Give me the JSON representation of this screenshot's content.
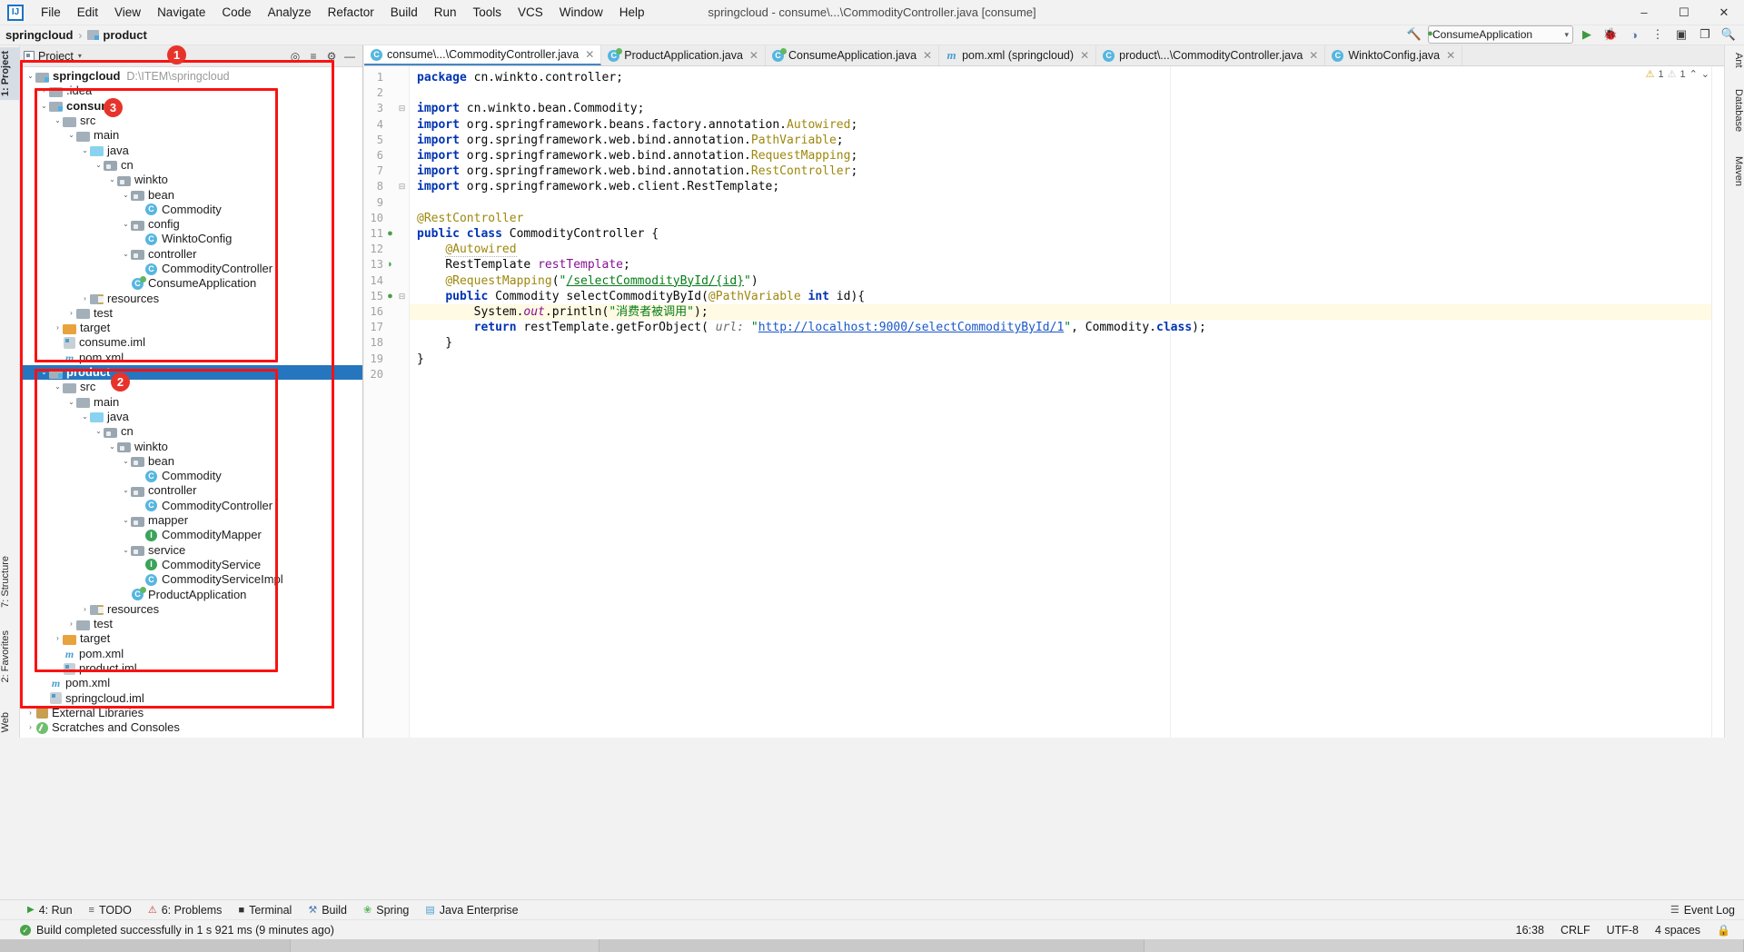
{
  "window": {
    "title": "springcloud - consume\\...\\CommodityController.java [consume]",
    "minimize": "–",
    "maximize": "☐",
    "close": "✕"
  },
  "menu": {
    "items": [
      "File",
      "Edit",
      "View",
      "Navigate",
      "Code",
      "Analyze",
      "Refactor",
      "Build",
      "Run",
      "Tools",
      "VCS",
      "Window",
      "Help"
    ]
  },
  "breadcrumb": {
    "project": "springcloud",
    "separator": "›",
    "module": "product"
  },
  "toolbar": {
    "build_hammer": "🔨",
    "run_config": "ConsumeApplication",
    "chevron": "▾",
    "run_label": "▶",
    "debug_label": "🐞",
    "coverage_label": "◑",
    "more_label": "⋮",
    "search_label": "🔍",
    "settings_label": "⚙",
    "layout1": "▣",
    "layout2": "❐"
  },
  "left_tool_strips": [
    {
      "label": "1: Project",
      "selected": true
    },
    {
      "label": "7: Structure",
      "selected": false
    },
    {
      "label": "2: Favorites",
      "selected": false
    },
    {
      "label": "Web",
      "selected": false
    }
  ],
  "right_tool_strips": [
    {
      "label": "Ant"
    },
    {
      "label": "Database"
    },
    {
      "label": "Maven"
    }
  ],
  "project_panel": {
    "header_label": "Project",
    "header_chevron": "▾",
    "icons": {
      "locate": "◎",
      "collapse": "≡",
      "settings": "⚙",
      "hide": "—"
    },
    "tree": [
      {
        "depth": 0,
        "arrow": "⌄",
        "icon": "module",
        "name": "springcloud",
        "bold": true,
        "path": "D:\\ITEM\\springcloud"
      },
      {
        "depth": 1,
        "arrow": "›",
        "icon": "folder",
        "name": ".idea"
      },
      {
        "depth": 1,
        "arrow": "⌄",
        "icon": "module",
        "name": "consume",
        "bold": true
      },
      {
        "depth": 2,
        "arrow": "⌄",
        "icon": "folder",
        "name": "src"
      },
      {
        "depth": 3,
        "arrow": "⌄",
        "icon": "folder",
        "name": "main"
      },
      {
        "depth": 4,
        "arrow": "⌄",
        "icon": "folder-blue",
        "name": "java"
      },
      {
        "depth": 5,
        "arrow": "⌄",
        "icon": "package",
        "name": "cn"
      },
      {
        "depth": 6,
        "arrow": "⌄",
        "icon": "package",
        "name": "winkto"
      },
      {
        "depth": 7,
        "arrow": "⌄",
        "icon": "package",
        "name": "bean"
      },
      {
        "depth": 8,
        "arrow": "",
        "icon": "class",
        "name": "Commodity"
      },
      {
        "depth": 7,
        "arrow": "⌄",
        "icon": "package",
        "name": "config"
      },
      {
        "depth": 8,
        "arrow": "",
        "icon": "class",
        "name": "WinktoConfig"
      },
      {
        "depth": 7,
        "arrow": "⌄",
        "icon": "package",
        "name": "controller"
      },
      {
        "depth": 8,
        "arrow": "",
        "icon": "class",
        "name": "CommodityController"
      },
      {
        "depth": 7,
        "arrow": "",
        "icon": "springapp",
        "name": "ConsumeApplication"
      },
      {
        "depth": 4,
        "arrow": "›",
        "icon": "resources",
        "name": "resources"
      },
      {
        "depth": 3,
        "arrow": "›",
        "icon": "folder",
        "name": "test"
      },
      {
        "depth": 2,
        "arrow": "›",
        "icon": "folder-orange",
        "name": "target"
      },
      {
        "depth": 2,
        "arrow": "",
        "icon": "iml",
        "name": "consume.iml"
      },
      {
        "depth": 2,
        "arrow": "",
        "icon": "xml",
        "name": "pom.xml"
      },
      {
        "depth": 1,
        "arrow": "⌄",
        "icon": "module",
        "name": "product",
        "bold": true,
        "selected": true
      },
      {
        "depth": 2,
        "arrow": "⌄",
        "icon": "folder",
        "name": "src"
      },
      {
        "depth": 3,
        "arrow": "⌄",
        "icon": "folder",
        "name": "main"
      },
      {
        "depth": 4,
        "arrow": "⌄",
        "icon": "folder-blue",
        "name": "java"
      },
      {
        "depth": 5,
        "arrow": "⌄",
        "icon": "package",
        "name": "cn"
      },
      {
        "depth": 6,
        "arrow": "⌄",
        "icon": "package",
        "name": "winkto"
      },
      {
        "depth": 7,
        "arrow": "⌄",
        "icon": "package",
        "name": "bean"
      },
      {
        "depth": 8,
        "arrow": "",
        "icon": "class",
        "name": "Commodity"
      },
      {
        "depth": 7,
        "arrow": "⌄",
        "icon": "package",
        "name": "controller"
      },
      {
        "depth": 8,
        "arrow": "",
        "icon": "class",
        "name": "CommodityController"
      },
      {
        "depth": 7,
        "arrow": "⌄",
        "icon": "package",
        "name": "mapper"
      },
      {
        "depth": 8,
        "arrow": "",
        "icon": "interface",
        "name": "CommodityMapper"
      },
      {
        "depth": 7,
        "arrow": "⌄",
        "icon": "package",
        "name": "service"
      },
      {
        "depth": 8,
        "arrow": "",
        "icon": "interface",
        "name": "CommodityService"
      },
      {
        "depth": 8,
        "arrow": "",
        "icon": "class",
        "name": "CommodityServiceImpl"
      },
      {
        "depth": 7,
        "arrow": "",
        "icon": "springapp",
        "name": "ProductApplication"
      },
      {
        "depth": 4,
        "arrow": "›",
        "icon": "resources",
        "name": "resources"
      },
      {
        "depth": 3,
        "arrow": "›",
        "icon": "folder",
        "name": "test"
      },
      {
        "depth": 2,
        "arrow": "›",
        "icon": "folder-orange",
        "name": "target"
      },
      {
        "depth": 2,
        "arrow": "",
        "icon": "xml",
        "name": "pom.xml"
      },
      {
        "depth": 2,
        "arrow": "",
        "icon": "iml",
        "name": "product.iml"
      },
      {
        "depth": 1,
        "arrow": "",
        "icon": "xml",
        "name": "pom.xml"
      },
      {
        "depth": 1,
        "arrow": "",
        "icon": "iml",
        "name": "springcloud.iml"
      },
      {
        "depth": 0,
        "arrow": "›",
        "icon": "library",
        "name": "External Libraries"
      },
      {
        "depth": 0,
        "arrow": "›",
        "icon": "scratch",
        "name": "Scratches and Consoles"
      }
    ]
  },
  "annotations": [
    {
      "number": "1"
    },
    {
      "number": "2"
    },
    {
      "number": "3"
    }
  ],
  "editor": {
    "tabs": [
      {
        "label": "consume\\...\\CommodityController.java",
        "icon": "class",
        "active": true,
        "close": "✕"
      },
      {
        "label": "ProductApplication.java",
        "icon": "springapp",
        "active": false,
        "close": "✕"
      },
      {
        "label": "ConsumeApplication.java",
        "icon": "springapp",
        "active": false,
        "close": "✕"
      },
      {
        "label": "pom.xml (springcloud)",
        "icon": "maven",
        "active": false,
        "close": "✕"
      },
      {
        "label": "product\\...\\CommodityController.java",
        "icon": "class",
        "active": false,
        "close": "✕"
      },
      {
        "label": "WinktoConfig.java",
        "icon": "class",
        "active": false,
        "close": "✕"
      }
    ],
    "inspections": {
      "warning_count": "1",
      "weak_count": "1",
      "up": "⌃",
      "down": "⌄"
    },
    "lines": [
      {
        "n": "1",
        "gutter": "",
        "fold": "",
        "html": "<span class=\"k\">package</span> cn.winkto.controller;"
      },
      {
        "n": "2",
        "gutter": "",
        "fold": "",
        "html": ""
      },
      {
        "n": "3",
        "gutter": "",
        "fold": "⊟",
        "html": "<span class=\"k\">import</span> cn.winkto.bean.Commodity;"
      },
      {
        "n": "4",
        "gutter": "",
        "fold": "",
        "html": "<span class=\"k\">import</span> org.springframework.beans.factory.annotation.<span class=\"ann\">Autowired</span>;"
      },
      {
        "n": "5",
        "gutter": "",
        "fold": "",
        "html": "<span class=\"k\">import</span> org.springframework.web.bind.annotation.<span class=\"ann\">PathVariable</span>;"
      },
      {
        "n": "6",
        "gutter": "",
        "fold": "",
        "html": "<span class=\"k\">import</span> org.springframework.web.bind.annotation.<span class=\"ann\">RequestMapping</span>;"
      },
      {
        "n": "7",
        "gutter": "",
        "fold": "",
        "html": "<span class=\"k\">import</span> org.springframework.web.bind.annotation.<span class=\"ann\">RestController</span>;"
      },
      {
        "n": "8",
        "gutter": "",
        "fold": "⊟",
        "html": "<span class=\"k\">import</span> org.springframework.web.client.RestTemplate;"
      },
      {
        "n": "9",
        "gutter": "",
        "fold": "",
        "html": ""
      },
      {
        "n": "10",
        "gutter": "",
        "fold": "",
        "html": "<span class=\"ann\">@RestController</span>"
      },
      {
        "n": "11",
        "gutter": "bean",
        "fold": "",
        "html": "<span class=\"k\">public class</span> CommodityController {"
      },
      {
        "n": "12",
        "gutter": "",
        "fold": "",
        "html": "    <span class=\"ann wavy\">@Autowired</span>"
      },
      {
        "n": "13",
        "gutter": "arrow",
        "fold": "",
        "html": "    RestTemplate <span class=\"fld\">restTemplate</span>;"
      },
      {
        "n": "14",
        "gutter": "",
        "fold": "",
        "html": "    <span class=\"ann\">@RequestMapping</span>(<span class=\"str\">\"</span><span class=\"url-str\">/selectCommodityById/{id}</span><span class=\"str\">\"</span>)"
      },
      {
        "n": "15",
        "gutter": "bean",
        "fold": "⊟",
        "html": "    <span class=\"k\">public</span> Commodity selectCommodityById(<span class=\"ann\">@PathVariable</span> <span class=\"k\">int</span> id){"
      },
      {
        "n": "16",
        "gutter": "",
        "fold": "",
        "html": "        System.<span class=\"sfld\">out</span>.println(<span class=\"str\">\"消费者被调用\"</span>);",
        "highlight": true
      },
      {
        "n": "17",
        "gutter": "",
        "fold": "",
        "html": "        <span class=\"k\">return</span> restTemplate.getForObject( <span class=\"pname\">url:</span> <span class=\"str\">\"</span><span class=\"lnk\">http://localhost:9000/selectCommodityById/1</span><span class=\"str\">\"</span>, Commodity.<span class=\"k\">class</span>);"
      },
      {
        "n": "18",
        "gutter": "",
        "fold": "",
        "html": "    }"
      },
      {
        "n": "19",
        "gutter": "",
        "fold": "",
        "html": "}"
      },
      {
        "n": "20",
        "gutter": "",
        "fold": "",
        "html": ""
      }
    ]
  },
  "bottom_tabs": [
    {
      "label": "4: Run",
      "icon": "run"
    },
    {
      "label": "TODO",
      "icon": "todo"
    },
    {
      "label": "6: Problems",
      "icon": "problems"
    },
    {
      "label": "Terminal",
      "icon": "terminal"
    },
    {
      "label": "Build",
      "icon": "build"
    },
    {
      "label": "Spring",
      "icon": "spring"
    },
    {
      "label": "Java Enterprise",
      "icon": "jee"
    }
  ],
  "event_log": {
    "label": "Event Log",
    "icon": "☰"
  },
  "status": {
    "message": "Build completed successfully in 1 s 921 ms (9 minutes ago)",
    "ok_icon": "✓",
    "time": "16:38",
    "line_sep": "CRLF",
    "encoding": "UTF-8",
    "indent": "4 spaces",
    "lock_icon": "🔒"
  },
  "colors": {
    "accent": "#2675bf",
    "annotation_red": "#fa1212",
    "keyword_blue": "#0033b3",
    "string_green": "#067d17",
    "annotation_gold": "#9e880d",
    "field_purple": "#871094",
    "highlight_yellow": "#fffae3"
  }
}
